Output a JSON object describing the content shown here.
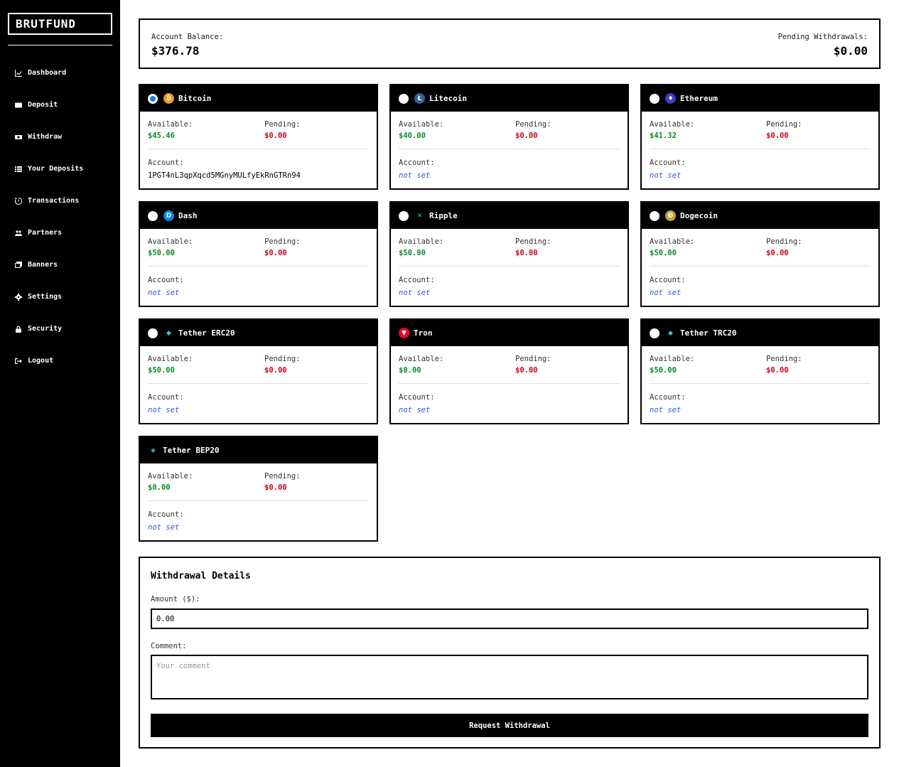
{
  "app": {
    "logo": "BRUTFUND"
  },
  "sidebar": {
    "items": [
      {
        "label": "Dashboard",
        "icon": "chart-line-icon"
      },
      {
        "label": "Deposit",
        "icon": "wallet-icon"
      },
      {
        "label": "Withdraw",
        "icon": "money-bill-icon"
      },
      {
        "label": "Your Deposits",
        "icon": "list-icon"
      },
      {
        "label": "Transactions",
        "icon": "history-icon"
      },
      {
        "label": "Partners",
        "icon": "users-icon"
      },
      {
        "label": "Banners",
        "icon": "images-icon"
      },
      {
        "label": "Settings",
        "icon": "gear-icon"
      },
      {
        "label": "Security",
        "icon": "lock-icon"
      },
      {
        "label": "Logout",
        "icon": "sign-out-icon"
      }
    ]
  },
  "balance": {
    "account_label": "Account Balance:",
    "account_value": "$376.78",
    "pending_label": "Pending Withdrawals:",
    "pending_value": "$0.00"
  },
  "labels": {
    "available": "Available:",
    "pending": "Pending:",
    "account": "Account:"
  },
  "cards": [
    {
      "name": "Bitcoin",
      "icon": "bitcoin-icon",
      "color": "#f7931a",
      "glyph": "₿",
      "radio": true,
      "selected": true,
      "available": "$45.46",
      "pending": "$0.00",
      "account": "1PGT4nL3qpXqcd5MGnyMULfyEkRnGTRn94",
      "account_set": true
    },
    {
      "name": "Litecoin",
      "icon": "litecoin-icon",
      "color": "#345d9d",
      "glyph": "Ł",
      "radio": true,
      "selected": false,
      "available": "$40.00",
      "pending": "$0.00",
      "account": "not set",
      "account_set": false
    },
    {
      "name": "Ethereum",
      "icon": "ethereum-icon",
      "color": "#3c3cc8",
      "glyph": "♦",
      "radio": true,
      "selected": false,
      "available": "$41.32",
      "pending": "$0.00",
      "account": "not set",
      "account_set": false
    },
    {
      "name": "Dash",
      "icon": "dash-icon",
      "color": "#008de4",
      "glyph": "D",
      "radio": true,
      "selected": false,
      "available": "$50.00",
      "pending": "$0.00",
      "account": "not set",
      "account_set": false
    },
    {
      "name": "Ripple",
      "icon": "ripple-icon",
      "color": "#000000",
      "glyph": "✕",
      "radio": true,
      "selected": false,
      "available": "$50.00",
      "pending": "$0.00",
      "account": "not set",
      "account_set": false
    },
    {
      "name": "Dogecoin",
      "icon": "dogecoin-icon",
      "color": "#c2a633",
      "glyph": "Ð",
      "radio": true,
      "selected": false,
      "available": "$50.00",
      "pending": "$0.00",
      "account": "not set",
      "account_set": false
    },
    {
      "name": "Tether ERC20",
      "icon": "tether-erc20-icon",
      "color": "#000000",
      "glyph": "◆",
      "radio": true,
      "selected": false,
      "available": "$50.00",
      "pending": "$0.00",
      "account": "not set",
      "account_set": false
    },
    {
      "name": "Tron",
      "icon": "tron-icon",
      "color": "#ef0027",
      "glyph": "▼",
      "radio": false,
      "selected": false,
      "available": "$0.00",
      "pending": "$0.00",
      "account": "not set",
      "account_set": false
    },
    {
      "name": "Tether TRC20",
      "icon": "tether-trc20-icon",
      "color": "#000000",
      "glyph": "◆",
      "radio": true,
      "selected": false,
      "available": "$50.00",
      "pending": "$0.00",
      "account": "not set",
      "account_set": false
    },
    {
      "name": "Tether BEP20",
      "icon": "tether-bep20-icon",
      "color": "#000000",
      "glyph": "◈",
      "radio": false,
      "selected": false,
      "available": "$0.00",
      "pending": "$0.00",
      "account": "not set",
      "account_set": false
    }
  ],
  "withdrawal": {
    "title": "Withdrawal Details",
    "amount_label": "Amount ($):",
    "amount_value": "0.00",
    "comment_label": "Comment:",
    "comment_placeholder": "Your comment",
    "button_label": "Request Withdrawal"
  }
}
